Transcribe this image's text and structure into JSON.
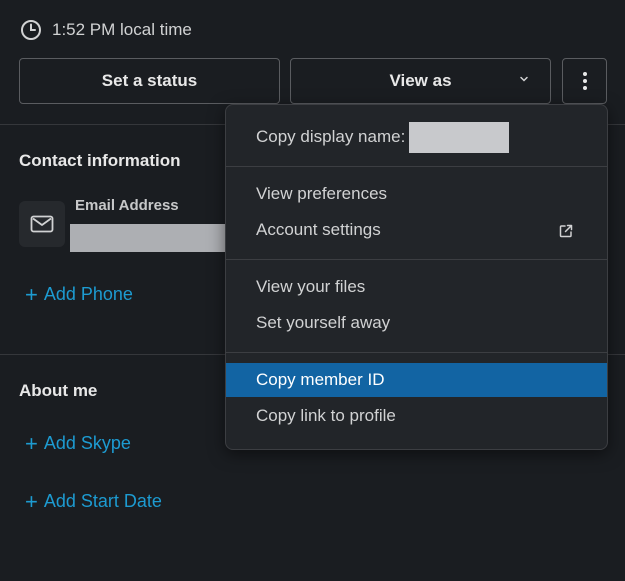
{
  "header": {
    "local_time": "1:52 PM local time",
    "clock_icon": "clock-icon"
  },
  "actions": {
    "set_status": "Set a status",
    "view_as": "View as",
    "more_icon": "vertical-ellipsis-icon"
  },
  "contact": {
    "title": "Contact information",
    "email_label": "Email Address",
    "add_phone": "Add Phone"
  },
  "about": {
    "title": "About me",
    "add_skype": "Add Skype",
    "add_start_date": "Add Start Date"
  },
  "menu": {
    "copy_display_name": "Copy display name:",
    "view_preferences": "View preferences",
    "account_settings": "Account settings",
    "view_files": "View your files",
    "set_away": "Set yourself away",
    "copy_member_id": "Copy member ID",
    "copy_link": "Copy link to profile",
    "active_item": "Copy member ID"
  },
  "colors": {
    "background": "#1a1d21",
    "menu_background": "#222529",
    "highlight": "#1264a3",
    "link": "#1d9bd1"
  }
}
